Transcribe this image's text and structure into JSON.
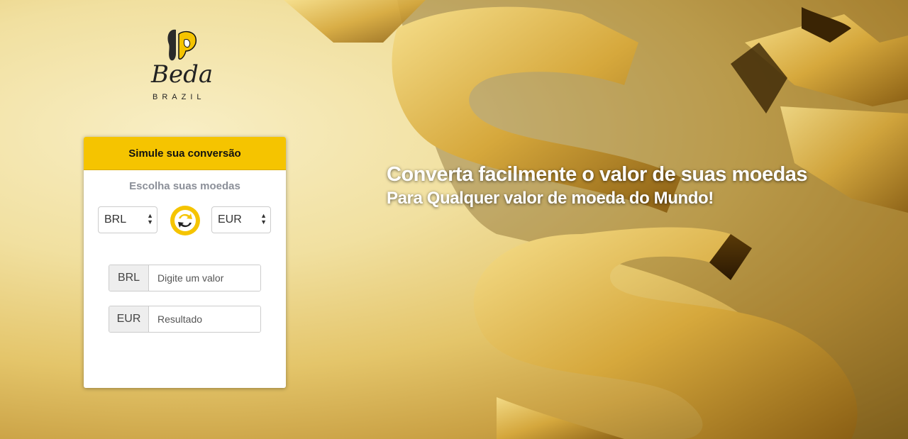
{
  "brand": {
    "name": "Beda",
    "tagline": "BRAZIL"
  },
  "converter": {
    "title": "Simule sua conversão",
    "subtitle": "Escolha suas moedas",
    "from_currency": "BRL",
    "to_currency": "EUR",
    "swap_icon": "swap-arrows-icon",
    "input_addon": "BRL",
    "input_placeholder": "Digite um valor",
    "result_addon": "EUR",
    "result_placeholder": "Resultado"
  },
  "hero": {
    "headline": "Converta facilmente o valor de suas moedas",
    "subheadline": "Para Qualquer valor de moeda do Mundo!"
  },
  "colors": {
    "accent": "#f5c400",
    "text_muted": "#8b8f98"
  }
}
